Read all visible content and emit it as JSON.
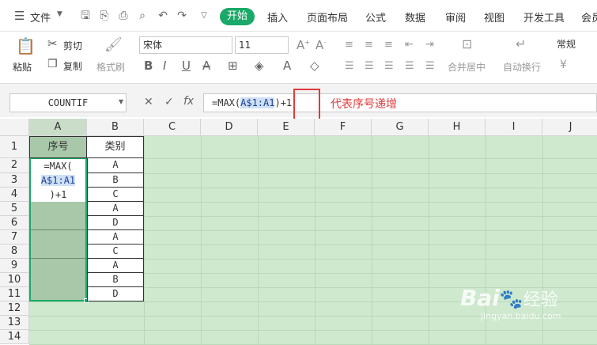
{
  "menubar": {
    "file_label": "文件",
    "tabs": [
      "开始",
      "插入",
      "页面布局",
      "公式",
      "数据",
      "审阅",
      "视图",
      "开发工具",
      "会员"
    ]
  },
  "ribbon": {
    "paste": "粘贴",
    "cut": "剪切",
    "copy": "复制",
    "format_painter": "格式刷",
    "font_name": "宋体",
    "font_size": "11",
    "merge_center": "合并居中",
    "wrap_text": "自动换行",
    "number_format": "常规",
    "currency": "¥"
  },
  "formula_bar": {
    "name_box": "COUNTIF",
    "formula_prefix": "=MAX(",
    "formula_ref": "A$1:A1",
    "formula_suffix": ")+1",
    "annotation": "代表序号递增"
  },
  "sheet": {
    "columns": [
      "A",
      "B",
      "C",
      "D",
      "E",
      "F",
      "G",
      "H",
      "I",
      "J"
    ],
    "rows": [
      "1",
      "2",
      "3",
      "4",
      "5",
      "6",
      "7",
      "8",
      "9",
      "10",
      "11",
      "12",
      "13",
      "14"
    ],
    "header_A": "序号",
    "header_B": "类别",
    "a2_lines": [
      "=MAX(",
      "A$1:A1",
      ")+1"
    ],
    "col_b": [
      "A",
      "B",
      "C",
      "A",
      "D",
      "A",
      "C",
      "A",
      "B",
      "D"
    ]
  },
  "watermark": {
    "brand": "Bai",
    "sub": "经验",
    "url": "jingyan.baidu.com"
  }
}
